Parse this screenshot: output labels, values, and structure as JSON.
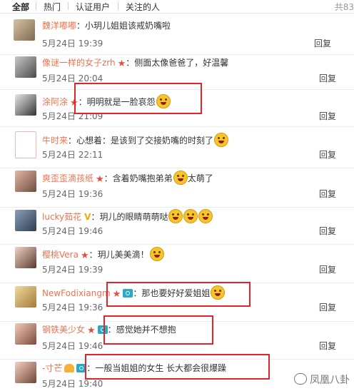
{
  "tabs": [
    "全部",
    "热门",
    "认证用户",
    "关注的人"
  ],
  "total_text": "共83",
  "reply_label": "回复",
  "watermark_text": "凤凰八卦",
  "comments": [
    {
      "user": "魏洋嘟嘟",
      "text": "：小玥儿姐姐该戒奶嘴啦",
      "date": "5月24日 19:39"
    },
    {
      "user": "像谜一样的女子zrh",
      "text": "：侧面太像爸爸了，好温馨",
      "date": "5月24日 20:04"
    },
    {
      "user": "涂阿涂",
      "text": "：明明就是一脸哀怨",
      "date": "5月24日 21:09"
    },
    {
      "user": "牛时来",
      "text": "：心想着：是该到了交接奶嘴的时刻了",
      "date": "5月24日 22:11"
    },
    {
      "user": "爽歪歪滴孩纸",
      "text": "：含着奶嘴抱弟弟",
      "text2": "太萌了",
      "date": "5月24日 19:36"
    },
    {
      "user": "lucky茹花",
      "text": "：玥儿的眼睛萌萌哒",
      "date": "5月24日 19:46"
    },
    {
      "user": "樱桃Vera",
      "text": "：玥儿美美滴！",
      "date": "5月24日 19:39"
    },
    {
      "user": "NewFodixiangm",
      "text": "：那也要好好爱姐姐",
      "date": "5月24日 19:36"
    },
    {
      "user": "钢铁美少女",
      "text": "：感觉她并不想抱",
      "date": "5月24日 19:46"
    },
    {
      "user": "-寸芒",
      "text": "：一般当姐姐的女生 长大都会很爆躁",
      "date": "5月24日 19:40"
    }
  ],
  "colors": {
    "username": "#eb7350",
    "star": "#e94c3d",
    "highlight_box": "#e0242a"
  }
}
